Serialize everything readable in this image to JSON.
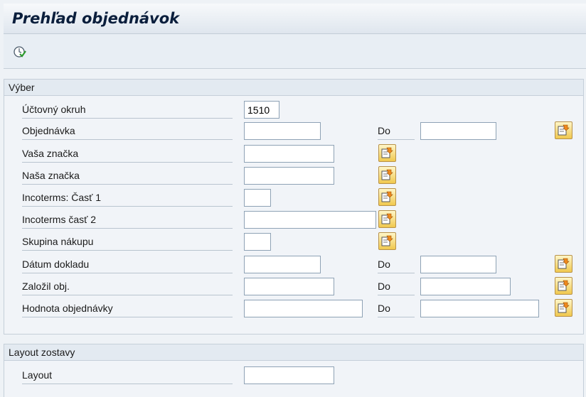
{
  "header": {
    "title": "Prehľad objednávok"
  },
  "toolbar": {
    "execute_icon": "execute-clock-icon"
  },
  "selection": {
    "title": "Výber",
    "to_label": "Do",
    "fields": [
      {
        "label": "Účtovný okruh",
        "value": "1510"
      },
      {
        "label": "Objednávka",
        "value": ""
      },
      {
        "label": "Vaša značka",
        "value": ""
      },
      {
        "label": "Naša značka",
        "value": ""
      },
      {
        "label": "Incoterms: Časť 1",
        "value": ""
      },
      {
        "label": "Incoterms časť 2",
        "value": ""
      },
      {
        "label": "Skupina nákupu",
        "value": ""
      },
      {
        "label": "Dátum dokladu",
        "value": ""
      },
      {
        "label": "Založil obj.",
        "value": ""
      },
      {
        "label": "Hodnota objednávky",
        "value": ""
      }
    ]
  },
  "layout_section": {
    "title": "Layout zostavy",
    "field_label": "Layout",
    "value": ""
  },
  "colors": {
    "multiselect_button": "#f0c84e",
    "title_text": "#0a1e3c"
  }
}
